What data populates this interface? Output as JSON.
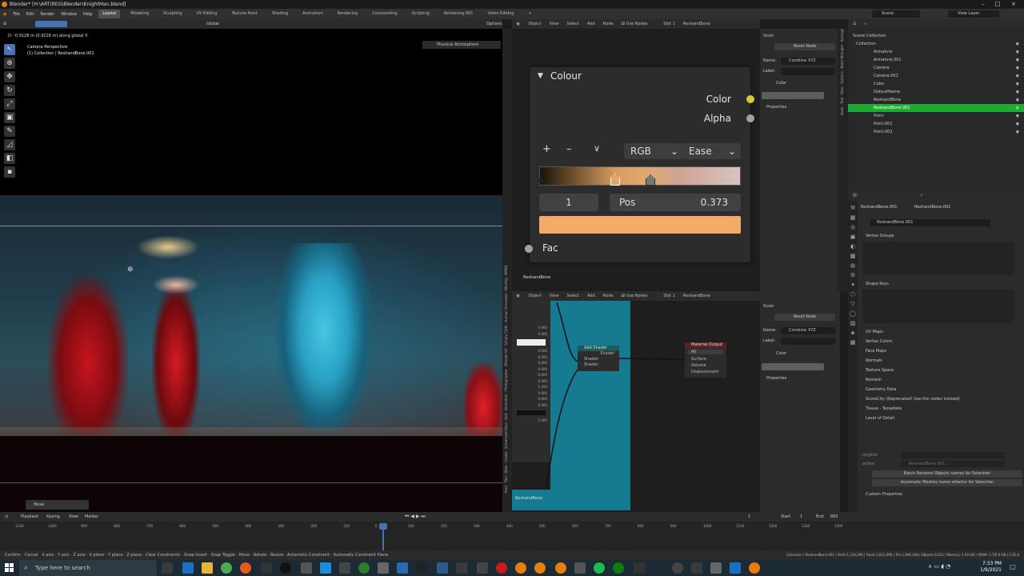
{
  "window": {
    "title": "Blender* [H:\\ART\\REG\\Blender\\KnightMan.blend]",
    "controls": [
      "–",
      "□",
      "×"
    ]
  },
  "menubar": {
    "menus": [
      "File",
      "Edit",
      "Render",
      "Window",
      "Help"
    ],
    "workspaces": [
      "Layout",
      "Modeling",
      "Sculpting",
      "UV Editing",
      "Texture Paint",
      "Shading",
      "Animation",
      "Rendering",
      "Compositing",
      "Scripting",
      "Rendering.001",
      "Video Editing",
      "+"
    ],
    "active_workspace": "Layout",
    "scene_label": "Scene",
    "view_layer_label": "View Layer"
  },
  "viewport": {
    "header_orientation": "Global",
    "header_options": "Options",
    "status_line": "D: -0.9128 m (0.9128 m) along global X",
    "camera_title": "Camera Perspective",
    "camera_subtitle": "(1) Collection | ReshandBone.001",
    "atmosphere_label": "Physical Atmosphere",
    "operator_panel": "Move"
  },
  "node_editor_top": {
    "header_items": [
      "Object",
      "View",
      "Select",
      "Add",
      "Node",
      "Use Nodes",
      "Slot 1",
      "ReshandBone"
    ],
    "use_nodes_checked": true,
    "object_label": "ReshandBone",
    "panel": {
      "title": "Colour",
      "outputs": [
        {
          "label": "Color",
          "color": "#d8c63a"
        },
        {
          "label": "Alpha",
          "color": "#a1a1a1"
        }
      ],
      "buttons": [
        "+",
        "–",
        "∨"
      ],
      "mode": "RGB",
      "interpolation": "Ease",
      "stop_index": "1",
      "pos_label": "Pos",
      "pos_value": "0.373",
      "swatch_color": "#f2ac6a",
      "input_label": "Fac"
    }
  },
  "node_sidebar_top": {
    "section": "Node",
    "reset_button": "Reset Node",
    "name_label": "Name:",
    "name_value": "Combine XYZ",
    "label_label": "Label:",
    "color_label": "Color",
    "properties_label": "Properties",
    "tabs": [
      "Node",
      "Tool",
      "View",
      "Options",
      "Node Wrangler",
      "Arrange"
    ]
  },
  "viewport_tabs": [
    "Item",
    "Tool",
    "View",
    "Create",
    "Screencast Keys",
    "Edit",
    "Animation",
    "Photographer",
    "Blender Kit",
    "Simply Cloth",
    "Human Generator",
    "BlenRig",
    "NMKD"
  ],
  "node_editor_bot": {
    "header_items": [
      "Object",
      "View",
      "Select",
      "Add",
      "Node",
      "Use Nodes",
      "Slot 1",
      "ReshandBone"
    ],
    "nodes": {
      "add_shader": {
        "title": "Add Shader",
        "output": "Shader",
        "inputs": [
          "Shader",
          "Shader"
        ]
      },
      "material_output": {
        "title": "Material Output",
        "target": "All",
        "inputs": [
          "Surface",
          "Volume",
          "Displacement"
        ]
      }
    },
    "left_values": [
      "0.000",
      "0.000",
      "0.000",
      "0.000",
      "0.000",
      "0.000",
      "0.000",
      "0.000",
      "1.450",
      "0.000",
      "0.000",
      "0.000",
      "1.000"
    ],
    "footer_label": "ReshandBone",
    "sidebar": {
      "section": "Node",
      "reset_button": "Reset Node",
      "name_label": "Name:",
      "name_value": "Combine XYZ",
      "label_label": "Label:",
      "color_label": "Color",
      "properties_label": "Properties"
    }
  },
  "outliner": {
    "root": "Scene Collection",
    "collection": "Collection",
    "items": [
      {
        "name": "Armature",
        "selected": false
      },
      {
        "name": "Armature.001",
        "selected": false
      },
      {
        "name": "Camera",
        "selected": false
      },
      {
        "name": "Camera.001",
        "selected": false
      },
      {
        "name": "Cube",
        "selected": false
      },
      {
        "name": "DefaultName",
        "selected": false
      },
      {
        "name": "ReshandBone",
        "selected": false
      },
      {
        "name": "ReshandBone.001",
        "selected": true
      },
      {
        "name": "Point",
        "selected": false
      },
      {
        "name": "Point.001",
        "selected": false
      },
      {
        "name": "Point.002",
        "selected": false
      }
    ]
  },
  "properties": {
    "breadcrumb_object": "ReshandBone.001",
    "breadcrumb_data": "ReshandBone.001",
    "mesh_name": "ReshandBone.001",
    "vertex_groups": "Vertex Groups",
    "shape_keys": "Shape Keys",
    "sections": [
      "UV Maps",
      "Vertex Colors",
      "Face Maps",
      "Normals",
      "Texture Space",
      "Remesh",
      "Geometry Data",
      "ScoreCity (Deprecated! Use the nodes instead)",
      "Tissue - Tessellate",
      "Level of Detail"
    ],
    "original_label": "original",
    "active_label": "active",
    "active_value": "ReshandBone.001",
    "batch_button": "Batch Rename Objects names for Selection",
    "auto_button": "Automatic Meshes name refactor for Selection",
    "custom_properties": "Custom Properties"
  },
  "timeline": {
    "header_items": [
      "Playback",
      "Keying",
      "View",
      "Marker"
    ],
    "current_frame": "1",
    "start_label": "Start",
    "start_value": "1",
    "end_label": "End",
    "end_value": "895",
    "ticks": [
      "-1100",
      "-1000",
      "-900",
      "-800",
      "-700",
      "-600",
      "-500",
      "-400",
      "-300",
      "-200",
      "-100",
      "0",
      "100",
      "200",
      "300",
      "400",
      "500",
      "600",
      "700",
      "800",
      "900",
      "1000",
      "1100",
      "1200",
      "1300",
      "1400"
    ]
  },
  "statusbar": {
    "hints": [
      "Confirm",
      "Cancel",
      "X axis",
      "Y axis",
      "Z axis",
      "X plane",
      "Y plane",
      "Z plane",
      "Clear Constraints",
      "Snap Invert",
      "Snap Toggle",
      "Move",
      "Rotate",
      "Resize",
      "Automatic Constraint",
      "Automatic Constraint Plane"
    ],
    "stats": "Collection | ReshandBone.001 | Verts:1,114,296 | Faces:1,812,066 | Tris:1,840,308 | Objects:1/353 | Memory: 1.59 GB | VRAM: 2.7/6.0 GB | 2.91.0"
  },
  "taskbar": {
    "search_placeholder": "Type here to search",
    "time": "7:33 PM",
    "date": "1/9/2021"
  }
}
